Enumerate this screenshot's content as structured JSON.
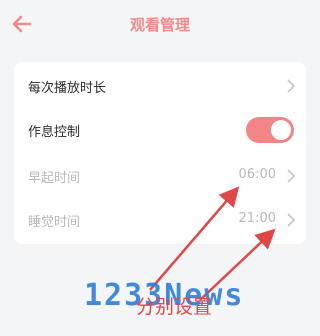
{
  "header": {
    "title": "观看管理"
  },
  "settings": {
    "items": [
      {
        "label": "每次播放时长",
        "value": ""
      },
      {
        "label": "作息控制",
        "toggle_on": true
      },
      {
        "label": "早起时间",
        "value": "06:00"
      },
      {
        "label": "睡觉时间",
        "value": "21:00"
      }
    ]
  },
  "annotation": {
    "caption": "分别设置",
    "watermark": "1233News"
  },
  "colors": {
    "accent": "#f28585",
    "title": "#f08c8c",
    "arrow": "#e04848",
    "watermark": "#2f7fd6"
  }
}
